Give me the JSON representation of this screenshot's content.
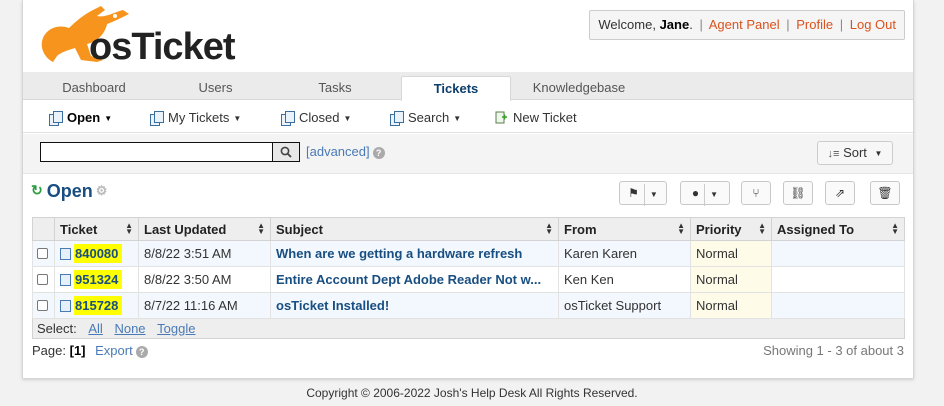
{
  "logo": {
    "text": "osTicket"
  },
  "user_bar": {
    "welcome": "Welcome,",
    "name": "Jane",
    "dot": ".",
    "links": [
      "Agent Panel",
      "Profile",
      "Log Out"
    ],
    "separator": "|"
  },
  "nav": {
    "tabs": [
      {
        "label": "Dashboard",
        "active": false
      },
      {
        "label": "Users",
        "active": false
      },
      {
        "label": "Tasks",
        "active": false
      },
      {
        "label": "Tickets",
        "active": true
      },
      {
        "label": "Knowledgebase",
        "active": false
      }
    ]
  },
  "subnav": {
    "items": [
      {
        "label": "Open",
        "icon": "tickets-icon",
        "dropdown": true,
        "active": true
      },
      {
        "label": "My Tickets",
        "icon": "tickets-icon",
        "dropdown": true,
        "active": false
      },
      {
        "label": "Closed",
        "icon": "tickets-icon",
        "dropdown": true,
        "active": false
      },
      {
        "label": "Search",
        "icon": "tickets-icon",
        "dropdown": true,
        "active": false
      },
      {
        "label": "New Ticket",
        "icon": "new-ticket-icon",
        "dropdown": false,
        "active": false
      }
    ]
  },
  "search": {
    "value": "",
    "placeholder": "",
    "advanced_label": "[advanced]",
    "help": "?"
  },
  "sort": {
    "label": "Sort"
  },
  "queue": {
    "title": "Open",
    "actions": [
      "flag-icon",
      "user-icon",
      "merge-icon",
      "link-icon",
      "share-icon",
      "trash-icon"
    ]
  },
  "table": {
    "columns": [
      "Ticket",
      "Last Updated",
      "Subject",
      "From",
      "Priority",
      "Assigned To"
    ],
    "rows": [
      {
        "ticket": "840080",
        "updated": "8/8/22 3:51 AM",
        "subject": "When are we getting a hardware refresh",
        "from": "Karen Karen",
        "priority": "Normal",
        "assigned": ""
      },
      {
        "ticket": "951324",
        "updated": "8/8/22 3:50 AM",
        "subject": "Entire Account Dept Adobe Reader Not w...",
        "from": "Ken Ken",
        "priority": "Normal",
        "assigned": ""
      },
      {
        "ticket": "815728",
        "updated": "8/7/22 11:16 AM",
        "subject": "osTicket Installed!",
        "from": "osTicket Support",
        "priority": "Normal",
        "assigned": ""
      }
    ],
    "select": {
      "label": "Select:",
      "all": "All",
      "none": "None",
      "toggle": "Toggle"
    }
  },
  "pagination": {
    "label": "Page:",
    "current": "[1]",
    "export": "Export",
    "showing": "Showing 1 - 3 of about 3"
  },
  "footer": {
    "copyright": "Copyright © 2006-2022 Josh's Help Desk All Rights Reserved."
  },
  "colors": {
    "brand_orange": "#f7941d",
    "link_orange": "#d9531e",
    "heading_blue": "#184e81",
    "highlight": "#ffff00"
  }
}
